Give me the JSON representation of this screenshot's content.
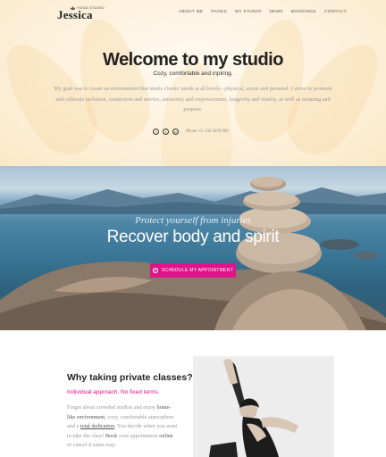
{
  "logo": {
    "tagline": "YOGA STUDIO",
    "name": "Jessica"
  },
  "nav": [
    "ABOUT ME",
    "PAGES",
    "MY STUDIO",
    "NEWS",
    "BOOKINGS",
    "CONTACT"
  ],
  "hero": {
    "title": "Welcome to my studio",
    "subtitle": "Cozy, comfortable and inpiring.",
    "intro": "My goal was to create an environment that meets clients' needs at all levels - physical, social and personal. I strive to promote and cultivate inclusion, connection and service, autonomy and empowerment, longevity and vitality, as well as meaning and purpose.",
    "social_icons": [
      "facebook-icon",
      "twitter-icon",
      "pinterest-icon"
    ],
    "phone": "Phone: 01 234 5678 900"
  },
  "banner": {
    "tagline": "Protect yourself from injuries",
    "headline": "Recover body and spirit",
    "cta_label": "SCHEDULE MY APPOINTMENT"
  },
  "why": {
    "title": "Why taking private classes?",
    "subtitle": "Individual approach. No fixed terms.",
    "text_parts": {
      "p1": "Forget about crowded studios and enjoy ",
      "b1": "home-like environment",
      "p2": ", cozy, comfortable atmosphere and a ",
      "u1": "total dedication",
      "p3": ". You decide when you want to take the class! ",
      "b2": "Book",
      "p4": " your appointment ",
      "b3": "online",
      "p5": " or cancel it same way."
    }
  },
  "colors": {
    "accent": "#e0148a",
    "hero_bg": "#fdf1dc"
  }
}
